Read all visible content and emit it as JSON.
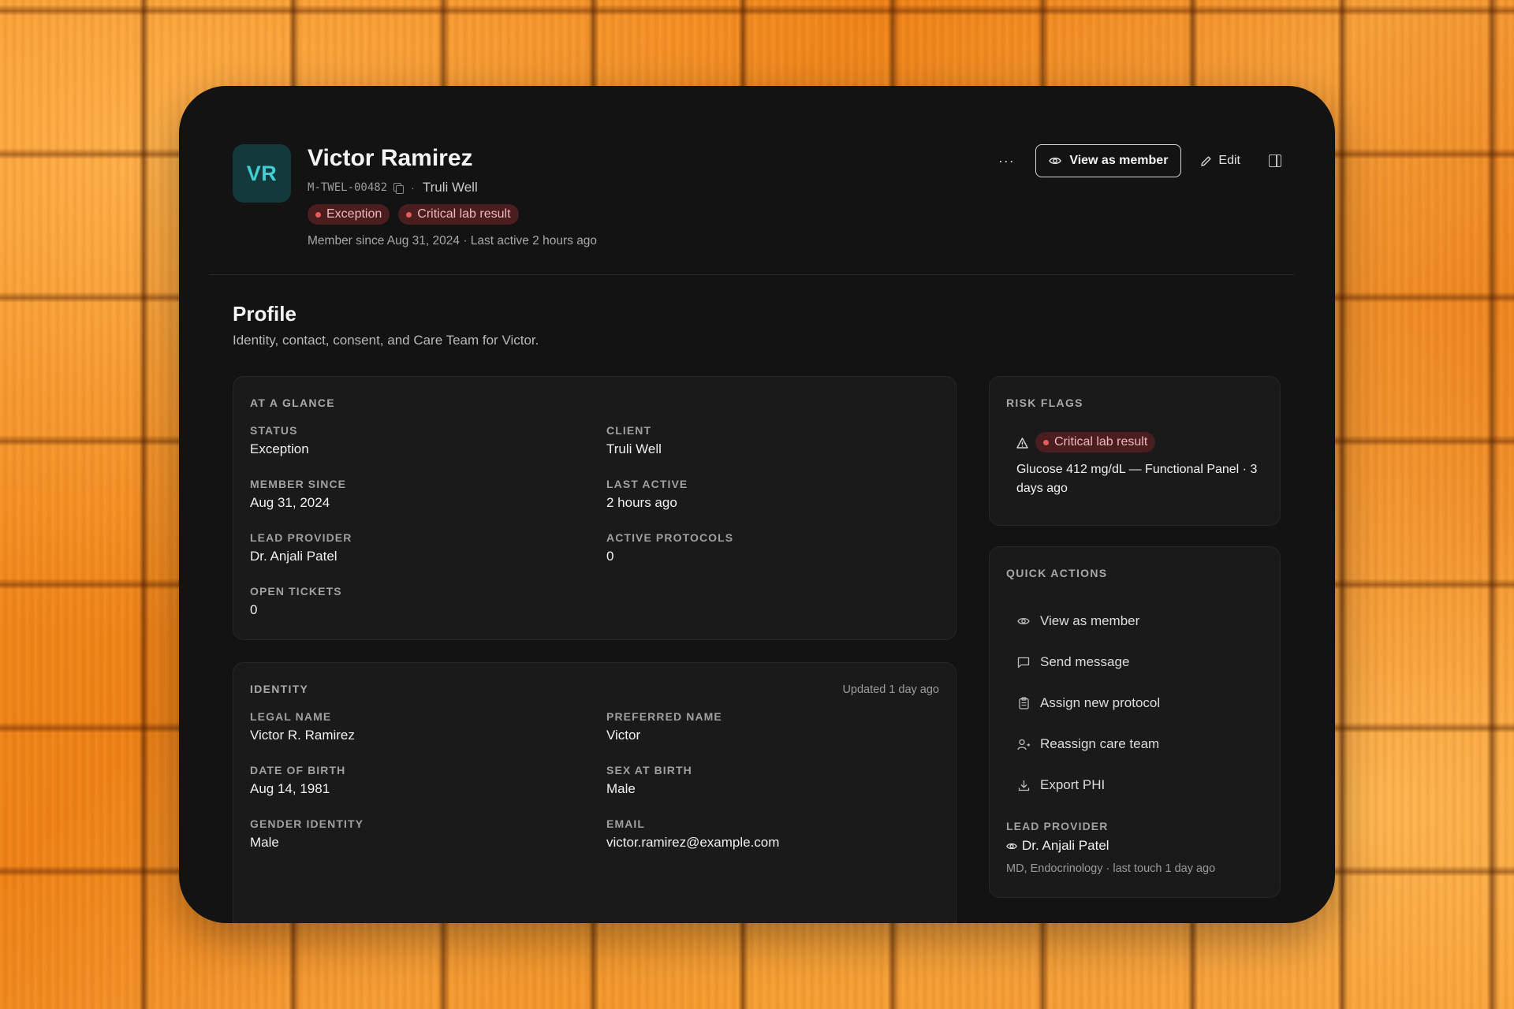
{
  "member": {
    "initials": "VR",
    "name": "Victor Ramirez",
    "id": "M-TWEL-00482",
    "separator": "·",
    "client": "Truli Well",
    "badges": [
      "Exception",
      "Critical lab result"
    ],
    "since_line": "Member since Aug 31, 2024 · Last active 2 hours ago"
  },
  "actions": {
    "more": "···",
    "view_as_member": "View as member",
    "edit": "Edit"
  },
  "section": {
    "title": "Profile",
    "subtitle": "Identity, contact, consent, and Care Team for Victor."
  },
  "glance": {
    "title": "AT A GLANCE",
    "fields": [
      {
        "label": "STATUS",
        "value": "Exception"
      },
      {
        "label": "CLIENT",
        "value": "Truli Well"
      },
      {
        "label": "MEMBER SINCE",
        "value": "Aug 31, 2024"
      },
      {
        "label": "LAST ACTIVE",
        "value": "2 hours ago"
      },
      {
        "label": "LEAD PROVIDER",
        "value": "Dr. Anjali Patel"
      },
      {
        "label": "ACTIVE PROTOCOLS",
        "value": "0"
      },
      {
        "label": "OPEN TICKETS",
        "value": "0"
      }
    ]
  },
  "identity": {
    "title": "IDENTITY",
    "updated": "Updated 1 day ago",
    "fields": [
      {
        "label": "LEGAL NAME",
        "value": "Victor R. Ramirez"
      },
      {
        "label": "PREFERRED NAME",
        "value": "Victor"
      },
      {
        "label": "DATE OF BIRTH",
        "value": "Aug 14, 1981"
      },
      {
        "label": "SEX AT BIRTH",
        "value": "Male"
      },
      {
        "label": "GENDER IDENTITY",
        "value": "Male"
      },
      {
        "label": "EMAIL",
        "value": "victor.ramirez@example.com"
      }
    ]
  },
  "risk": {
    "title": "RISK FLAGS",
    "flag": "Critical lab result",
    "description": "Glucose 412 mg/dL — Functional Panel · 3 days ago"
  },
  "quick_actions": {
    "title": "QUICK ACTIONS",
    "items": [
      {
        "label": "View as member",
        "icon": "eye-icon"
      },
      {
        "label": "Send message",
        "icon": "message-icon"
      },
      {
        "label": "Assign new protocol",
        "icon": "clipboard-icon"
      },
      {
        "label": "Reassign care team",
        "icon": "user-switch-icon"
      },
      {
        "label": "Export PHI",
        "icon": "download-icon"
      }
    ],
    "lead_provider_label": "LEAD PROVIDER",
    "lead_provider_name": "Dr. Anjali Patel",
    "lead_provider_meta": "MD, Endocrinology · last touch 1 day ago"
  },
  "colors": {
    "badge_bg": "#4a1d1f",
    "badge_dot": "#e55c5c",
    "avatar_bg": "#13393b",
    "avatar_text": "#3fd0d3",
    "card_bg": "#131313"
  }
}
